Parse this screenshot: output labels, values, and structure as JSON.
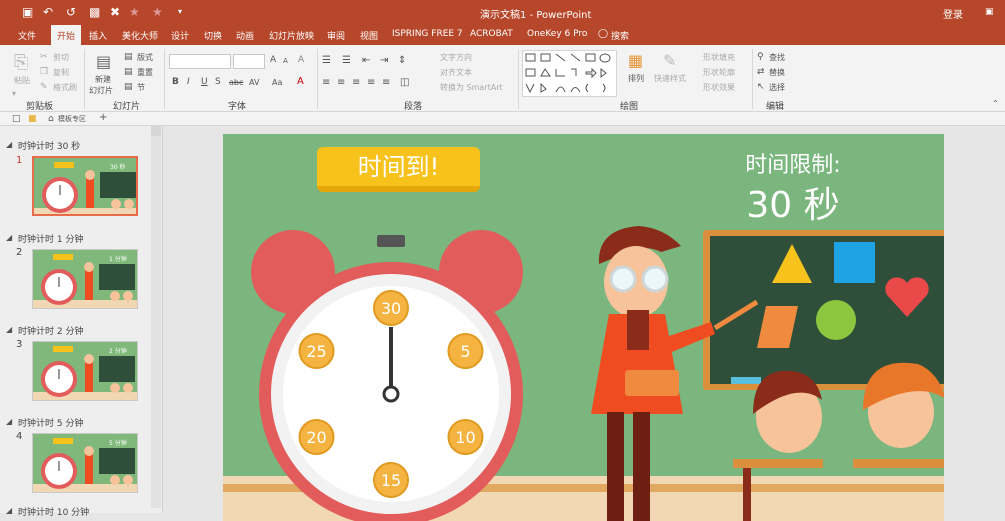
{
  "window": {
    "title": "演示文稿1 - PowerPoint",
    "login": "登录"
  },
  "tabs": [
    "文件",
    "开始",
    "插入",
    "美化大师",
    "设计",
    "切换",
    "动画",
    "幻灯片放映",
    "审阅",
    "视图",
    "ISPRING FREE 7",
    "ACROBAT",
    "OneKey 6 Pro"
  ],
  "search": "搜索",
  "ribbon": {
    "clipboard": {
      "paste": "粘贴",
      "cut": "剪切",
      "copy": "复制",
      "format_painter": "格式刷",
      "label": "剪贴板"
    },
    "slides": {
      "new_slide_1": "新建",
      "new_slide_2": "幻灯片",
      "layout": "版式",
      "reset": "重置",
      "section": "节",
      "label": "幻灯片"
    },
    "font": {
      "label": "字体",
      "bold": "B",
      "italic": "I",
      "underline": "U",
      "strike": "S",
      "shadow": "abc",
      "spacing": "AV",
      "case": "Aa",
      "grow": "A",
      "shrink": "A",
      "clear": "A",
      "color": "A"
    },
    "paragraph": {
      "text_direction": "文字方向",
      "align_text": "对齐文本",
      "smartart": "转换为 SmartArt",
      "label": "段落"
    },
    "drawing": {
      "arrange": "排列",
      "quick_styles": "快速样式",
      "shape_fill": "形状填充",
      "shape_outline": "形状轮廓",
      "shape_effects": "形状效果",
      "label": "绘图"
    },
    "editing": {
      "find": "查找",
      "replace": "替换",
      "select": "选择",
      "label": "编辑"
    }
  },
  "pathbar": {
    "template_zone": "模板专区",
    "add": "+"
  },
  "sections": [
    {
      "title": "时钟计时 30 秒",
      "num": "1",
      "label": "30 秒"
    },
    {
      "title": "时钟计时 1 分钟",
      "num": "2",
      "label": "1 分钟"
    },
    {
      "title": "时钟计时 2 分钟",
      "num": "3",
      "label": "2 分钟"
    },
    {
      "title": "时钟计时 5 分钟",
      "num": "4",
      "label": "5 分钟"
    },
    {
      "title": "时钟计时 10 分钟",
      "num": "",
      "label": ""
    }
  ],
  "slide": {
    "banner": "时间到!",
    "limit_label": "时间限制:",
    "limit_value": "30 秒",
    "clock_marks": [
      "30",
      "5",
      "10",
      "15",
      "20",
      "25"
    ]
  },
  "colors": {
    "accent": "#b7472a",
    "slide_bg": "#7ab67d",
    "board": "#2f4f3b",
    "banner": "#f7c21b",
    "clock_red": "#e35c5c",
    "coin": "#f5b342"
  }
}
